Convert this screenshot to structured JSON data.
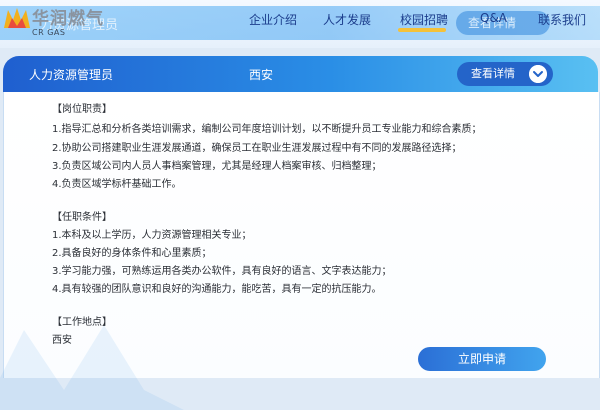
{
  "header": {
    "logo_text": "华润燃气",
    "logo_en": "CR GAS",
    "ghost_title": "力资源管理员",
    "ghost_button": "查看详情",
    "nav": [
      {
        "label": "企业介绍"
      },
      {
        "label": "人才发展"
      },
      {
        "label": "校园招聘",
        "active": true
      },
      {
        "label": "Q&A"
      },
      {
        "label": "联系我们"
      }
    ],
    "active_color": "#f4c13a"
  },
  "job": {
    "title": "人力资源管理员",
    "city": "西安",
    "detail_button": "查看详情"
  },
  "sections": {
    "duties_title": "【岗位职责】",
    "duties": [
      "1.指导汇总和分析各类培训需求，编制公司年度培训计划，以不断提升员工专业能力和综合素质；",
      "2.协助公司搭建职业生涯发展通道，确保员工在职业生涯发展过程中有不同的发展路径选择；",
      "3.负责区域公司内人员人事档案管理，尤其是经理人档案审核、归档整理；",
      "4.负责区域学标杆基础工作。"
    ],
    "req_title": "【任职条件】",
    "reqs": [
      "1.本科及以上学历，人力资源管理相关专业；",
      "2.具备良好的身体条件和心里素质；",
      "3.学习能力强，可熟练运用各类办公软件，具有良好的语言、文字表达能力；",
      "4.具有较强的团队意识和良好的沟通能力，能吃苦，具有一定的抗压能力。"
    ],
    "location_title": "【工作地点】",
    "location": "西安"
  },
  "apply_button": "立即申请",
  "colors": {
    "brand_blue": "#1f5fcf",
    "light_blue": "#59c0f2",
    "text": "#2b2f36",
    "nav_text": "#1b3d8c"
  }
}
